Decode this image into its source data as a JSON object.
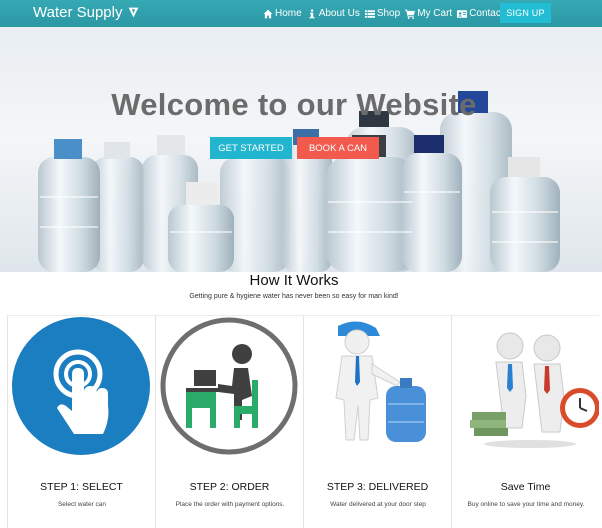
{
  "navbar": {
    "brand": "Water Supply",
    "links": [
      {
        "label": "Home",
        "icon": "home-icon"
      },
      {
        "label": "About Us",
        "icon": "info-icon"
      },
      {
        "label": "Shop",
        "icon": "list-icon"
      },
      {
        "label": "My Cart",
        "icon": "cart-icon"
      },
      {
        "label": "Contact Us",
        "icon": "contact-card-icon"
      }
    ],
    "signup": "SIGN UP"
  },
  "hero": {
    "title": "Welcome to our Website",
    "get_started": "GET STARTED",
    "book_can": "BOOK A CAN"
  },
  "how": {
    "title": "How It Works",
    "subtitle": "Getting pure & hygiene water has never been so easy for man kind!"
  },
  "steps": [
    {
      "title": "STEP 1: SELECT",
      "desc": "Select water can"
    },
    {
      "title": "STEP 2: ORDER",
      "desc": "Place the order with payment options."
    },
    {
      "title": "STEP 3: DELIVERED",
      "desc": "Water delivered at your door step"
    },
    {
      "title": "Save Time",
      "desc": "Buy online to save your time and money."
    }
  ],
  "colors": {
    "navbar": "#2fa1ad",
    "signup": "#22bdd4",
    "get_started": "#22b5cf",
    "book_can": "#f25a4e"
  }
}
